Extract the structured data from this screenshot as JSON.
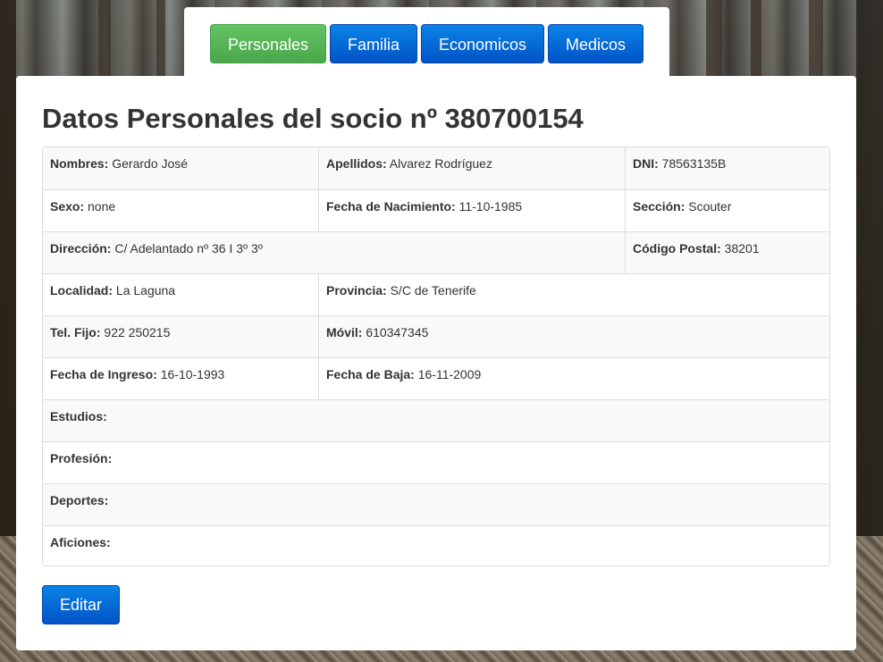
{
  "tabs": {
    "personales": "Personales",
    "familia": "Familia",
    "economicos": "Economicos",
    "medicos": "Medicos",
    "active": "Personales"
  },
  "colors": {
    "accent_blue": "#0253c7",
    "active_green": "#5cb85c"
  },
  "page_title": "Datos Personales del socio nº 380700154",
  "fields": {
    "nombres": {
      "label": "Nombres:",
      "value": "Gerardo José"
    },
    "apellidos": {
      "label": "Apellidos:",
      "value": "Alvarez Rodríguez"
    },
    "dni": {
      "label": "DNI:",
      "value": "78563135B"
    },
    "sexo": {
      "label": "Sexo:",
      "value": "none"
    },
    "fecha_nacimiento": {
      "label": "Fecha de Nacimiento:",
      "value": "11-10-1985"
    },
    "seccion": {
      "label": "Sección:",
      "value": "Scouter"
    },
    "direccion": {
      "label": "Dirección:",
      "value": "C/ Adelantado nº 36 I 3º 3º"
    },
    "codigo_postal": {
      "label": "Código Postal:",
      "value": "38201"
    },
    "localidad": {
      "label": "Localidad:",
      "value": "La Laguna"
    },
    "provincia": {
      "label": "Provincia:",
      "value": "S/C de Tenerife"
    },
    "tel_fijo": {
      "label": "Tel. Fijo:",
      "value": "922 250215"
    },
    "movil": {
      "label": "Móvil:",
      "value": "610347345"
    },
    "fecha_ingreso": {
      "label": "Fecha de Ingreso:",
      "value": "16-10-1993"
    },
    "fecha_baja": {
      "label": "Fecha de Baja:",
      "value": "16-11-2009"
    },
    "estudios": {
      "label": "Estudios:",
      "value": ""
    },
    "profesion": {
      "label": "Profesión:",
      "value": ""
    },
    "deportes": {
      "label": "Deportes:",
      "value": ""
    },
    "aficiones": {
      "label": "Aficiones:",
      "value": ""
    }
  },
  "actions": {
    "edit_label": "Editar"
  }
}
